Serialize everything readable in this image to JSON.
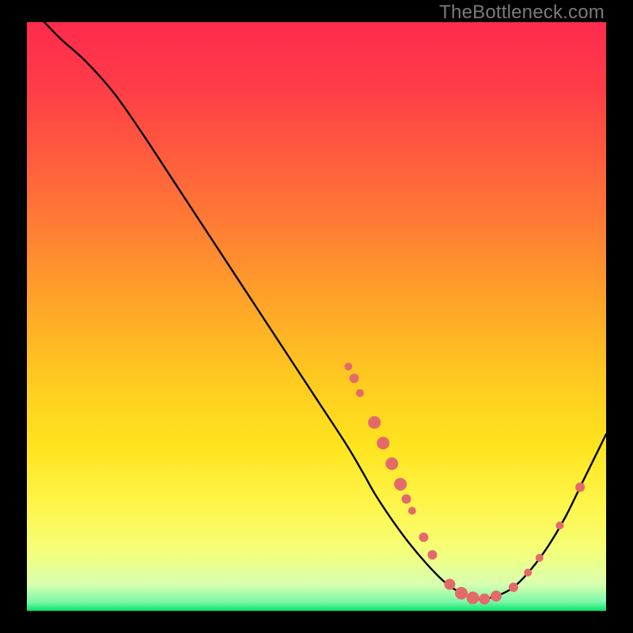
{
  "watermark": "TheBottleneck.com",
  "gradient": {
    "stops": [
      {
        "offset": 0.0,
        "color": "#ff2b4d"
      },
      {
        "offset": 0.1,
        "color": "#ff3a49"
      },
      {
        "offset": 0.22,
        "color": "#ff5a3e"
      },
      {
        "offset": 0.35,
        "color": "#ff7e33"
      },
      {
        "offset": 0.48,
        "color": "#ffa528"
      },
      {
        "offset": 0.6,
        "color": "#ffc820"
      },
      {
        "offset": 0.72,
        "color": "#ffe41e"
      },
      {
        "offset": 0.82,
        "color": "#fff54a"
      },
      {
        "offset": 0.9,
        "color": "#f4ff7a"
      },
      {
        "offset": 0.955,
        "color": "#d8ffb0"
      },
      {
        "offset": 0.985,
        "color": "#7cf7a8"
      },
      {
        "offset": 1.0,
        "color": "#00e46a"
      }
    ]
  },
  "chart_data": {
    "type": "line",
    "title": "",
    "xlabel": "",
    "ylabel": "",
    "xlim": [
      0,
      100
    ],
    "ylim": [
      0,
      100
    ],
    "series": [
      {
        "name": "curve",
        "x": [
          3,
          6,
          10,
          15,
          20,
          25,
          30,
          35,
          40,
          45,
          50,
          55,
          58,
          60,
          63,
          66,
          69,
          72,
          75,
          78,
          81,
          84,
          87,
          90,
          93,
          96,
          100
        ],
        "y": [
          100,
          97,
          93.5,
          88,
          81,
          73.5,
          66,
          58.5,
          51,
          43.5,
          36,
          28.5,
          23.5,
          20,
          15.5,
          11.5,
          8,
          5,
          3,
          2,
          2.5,
          4,
          7,
          11,
          16,
          22,
          30
        ]
      }
    ],
    "markers": {
      "name": "dots",
      "color": "#e46a6a",
      "points": [
        {
          "x": 55.5,
          "y": 41.5,
          "r": 5
        },
        {
          "x": 56.5,
          "y": 39.5,
          "r": 6
        },
        {
          "x": 57.5,
          "y": 37.0,
          "r": 5
        },
        {
          "x": 60.0,
          "y": 32.0,
          "r": 8
        },
        {
          "x": 61.5,
          "y": 28.5,
          "r": 8
        },
        {
          "x": 63.0,
          "y": 25.0,
          "r": 8
        },
        {
          "x": 64.5,
          "y": 21.5,
          "r": 8
        },
        {
          "x": 65.5,
          "y": 19.0,
          "r": 6
        },
        {
          "x": 66.5,
          "y": 17.0,
          "r": 5
        },
        {
          "x": 68.5,
          "y": 12.5,
          "r": 6
        },
        {
          "x": 70.0,
          "y": 9.5,
          "r": 6
        },
        {
          "x": 73.0,
          "y": 4.5,
          "r": 7
        },
        {
          "x": 75.0,
          "y": 3.0,
          "r": 8
        },
        {
          "x": 77.0,
          "y": 2.2,
          "r": 8
        },
        {
          "x": 79.0,
          "y": 2.0,
          "r": 7
        },
        {
          "x": 81.0,
          "y": 2.5,
          "r": 7
        },
        {
          "x": 84.0,
          "y": 4.0,
          "r": 6
        },
        {
          "x": 86.5,
          "y": 6.5,
          "r": 5
        },
        {
          "x": 88.5,
          "y": 9.0,
          "r": 5
        },
        {
          "x": 92.0,
          "y": 14.5,
          "r": 5
        },
        {
          "x": 95.5,
          "y": 21.0,
          "r": 6
        }
      ]
    }
  }
}
